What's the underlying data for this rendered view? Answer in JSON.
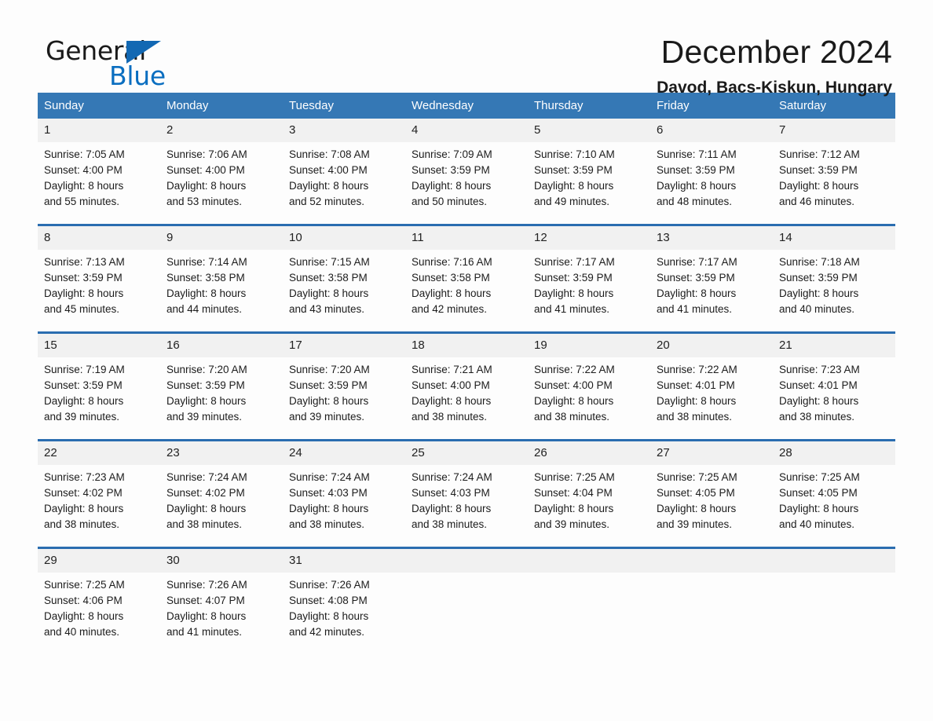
{
  "brand": {
    "name_part1": "General",
    "name_part2": "Blue",
    "triangle_color": "#1268b3",
    "blue_color": "#0a6ec0"
  },
  "header": {
    "month_title": "December 2024",
    "location": "Davod, Bacs-Kiskun, Hungary"
  },
  "theme": {
    "header_blue": "#3578b5",
    "row_divider_blue": "#2a6db0",
    "daynum_band": "#f1f1f1",
    "page_background": "#fdfdfd"
  },
  "calendar": {
    "weekday_headers": [
      "Sunday",
      "Monday",
      "Tuesday",
      "Wednesday",
      "Thursday",
      "Friday",
      "Saturday"
    ],
    "weeks": [
      [
        {
          "day": "1",
          "sunrise": "Sunrise: 7:05 AM",
          "sunset": "Sunset: 4:00 PM",
          "daylight_line1": "Daylight: 8 hours",
          "daylight_line2": "and 55 minutes."
        },
        {
          "day": "2",
          "sunrise": "Sunrise: 7:06 AM",
          "sunset": "Sunset: 4:00 PM",
          "daylight_line1": "Daylight: 8 hours",
          "daylight_line2": "and 53 minutes."
        },
        {
          "day": "3",
          "sunrise": "Sunrise: 7:08 AM",
          "sunset": "Sunset: 4:00 PM",
          "daylight_line1": "Daylight: 8 hours",
          "daylight_line2": "and 52 minutes."
        },
        {
          "day": "4",
          "sunrise": "Sunrise: 7:09 AM",
          "sunset": "Sunset: 3:59 PM",
          "daylight_line1": "Daylight: 8 hours",
          "daylight_line2": "and 50 minutes."
        },
        {
          "day": "5",
          "sunrise": "Sunrise: 7:10 AM",
          "sunset": "Sunset: 3:59 PM",
          "daylight_line1": "Daylight: 8 hours",
          "daylight_line2": "and 49 minutes."
        },
        {
          "day": "6",
          "sunrise": "Sunrise: 7:11 AM",
          "sunset": "Sunset: 3:59 PM",
          "daylight_line1": "Daylight: 8 hours",
          "daylight_line2": "and 48 minutes."
        },
        {
          "day": "7",
          "sunrise": "Sunrise: 7:12 AM",
          "sunset": "Sunset: 3:59 PM",
          "daylight_line1": "Daylight: 8 hours",
          "daylight_line2": "and 46 minutes."
        }
      ],
      [
        {
          "day": "8",
          "sunrise": "Sunrise: 7:13 AM",
          "sunset": "Sunset: 3:59 PM",
          "daylight_line1": "Daylight: 8 hours",
          "daylight_line2": "and 45 minutes."
        },
        {
          "day": "9",
          "sunrise": "Sunrise: 7:14 AM",
          "sunset": "Sunset: 3:58 PM",
          "daylight_line1": "Daylight: 8 hours",
          "daylight_line2": "and 44 minutes."
        },
        {
          "day": "10",
          "sunrise": "Sunrise: 7:15 AM",
          "sunset": "Sunset: 3:58 PM",
          "daylight_line1": "Daylight: 8 hours",
          "daylight_line2": "and 43 minutes."
        },
        {
          "day": "11",
          "sunrise": "Sunrise: 7:16 AM",
          "sunset": "Sunset: 3:58 PM",
          "daylight_line1": "Daylight: 8 hours",
          "daylight_line2": "and 42 minutes."
        },
        {
          "day": "12",
          "sunrise": "Sunrise: 7:17 AM",
          "sunset": "Sunset: 3:59 PM",
          "daylight_line1": "Daylight: 8 hours",
          "daylight_line2": "and 41 minutes."
        },
        {
          "day": "13",
          "sunrise": "Sunrise: 7:17 AM",
          "sunset": "Sunset: 3:59 PM",
          "daylight_line1": "Daylight: 8 hours",
          "daylight_line2": "and 41 minutes."
        },
        {
          "day": "14",
          "sunrise": "Sunrise: 7:18 AM",
          "sunset": "Sunset: 3:59 PM",
          "daylight_line1": "Daylight: 8 hours",
          "daylight_line2": "and 40 minutes."
        }
      ],
      [
        {
          "day": "15",
          "sunrise": "Sunrise: 7:19 AM",
          "sunset": "Sunset: 3:59 PM",
          "daylight_line1": "Daylight: 8 hours",
          "daylight_line2": "and 39 minutes."
        },
        {
          "day": "16",
          "sunrise": "Sunrise: 7:20 AM",
          "sunset": "Sunset: 3:59 PM",
          "daylight_line1": "Daylight: 8 hours",
          "daylight_line2": "and 39 minutes."
        },
        {
          "day": "17",
          "sunrise": "Sunrise: 7:20 AM",
          "sunset": "Sunset: 3:59 PM",
          "daylight_line1": "Daylight: 8 hours",
          "daylight_line2": "and 39 minutes."
        },
        {
          "day": "18",
          "sunrise": "Sunrise: 7:21 AM",
          "sunset": "Sunset: 4:00 PM",
          "daylight_line1": "Daylight: 8 hours",
          "daylight_line2": "and 38 minutes."
        },
        {
          "day": "19",
          "sunrise": "Sunrise: 7:22 AM",
          "sunset": "Sunset: 4:00 PM",
          "daylight_line1": "Daylight: 8 hours",
          "daylight_line2": "and 38 minutes."
        },
        {
          "day": "20",
          "sunrise": "Sunrise: 7:22 AM",
          "sunset": "Sunset: 4:01 PM",
          "daylight_line1": "Daylight: 8 hours",
          "daylight_line2": "and 38 minutes."
        },
        {
          "day": "21",
          "sunrise": "Sunrise: 7:23 AM",
          "sunset": "Sunset: 4:01 PM",
          "daylight_line1": "Daylight: 8 hours",
          "daylight_line2": "and 38 minutes."
        }
      ],
      [
        {
          "day": "22",
          "sunrise": "Sunrise: 7:23 AM",
          "sunset": "Sunset: 4:02 PM",
          "daylight_line1": "Daylight: 8 hours",
          "daylight_line2": "and 38 minutes."
        },
        {
          "day": "23",
          "sunrise": "Sunrise: 7:24 AM",
          "sunset": "Sunset: 4:02 PM",
          "daylight_line1": "Daylight: 8 hours",
          "daylight_line2": "and 38 minutes."
        },
        {
          "day": "24",
          "sunrise": "Sunrise: 7:24 AM",
          "sunset": "Sunset: 4:03 PM",
          "daylight_line1": "Daylight: 8 hours",
          "daylight_line2": "and 38 minutes."
        },
        {
          "day": "25",
          "sunrise": "Sunrise: 7:24 AM",
          "sunset": "Sunset: 4:03 PM",
          "daylight_line1": "Daylight: 8 hours",
          "daylight_line2": "and 38 minutes."
        },
        {
          "day": "26",
          "sunrise": "Sunrise: 7:25 AM",
          "sunset": "Sunset: 4:04 PM",
          "daylight_line1": "Daylight: 8 hours",
          "daylight_line2": "and 39 minutes."
        },
        {
          "day": "27",
          "sunrise": "Sunrise: 7:25 AM",
          "sunset": "Sunset: 4:05 PM",
          "daylight_line1": "Daylight: 8 hours",
          "daylight_line2": "and 39 minutes."
        },
        {
          "day": "28",
          "sunrise": "Sunrise: 7:25 AM",
          "sunset": "Sunset: 4:05 PM",
          "daylight_line1": "Daylight: 8 hours",
          "daylight_line2": "and 40 minutes."
        }
      ],
      [
        {
          "day": "29",
          "sunrise": "Sunrise: 7:25 AM",
          "sunset": "Sunset: 4:06 PM",
          "daylight_line1": "Daylight: 8 hours",
          "daylight_line2": "and 40 minutes."
        },
        {
          "day": "30",
          "sunrise": "Sunrise: 7:26 AM",
          "sunset": "Sunset: 4:07 PM",
          "daylight_line1": "Daylight: 8 hours",
          "daylight_line2": "and 41 minutes."
        },
        {
          "day": "31",
          "sunrise": "Sunrise: 7:26 AM",
          "sunset": "Sunset: 4:08 PM",
          "daylight_line1": "Daylight: 8 hours",
          "daylight_line2": "and 42 minutes."
        },
        {
          "day": "",
          "sunrise": "",
          "sunset": "",
          "daylight_line1": "",
          "daylight_line2": ""
        },
        {
          "day": "",
          "sunrise": "",
          "sunset": "",
          "daylight_line1": "",
          "daylight_line2": ""
        },
        {
          "day": "",
          "sunrise": "",
          "sunset": "",
          "daylight_line1": "",
          "daylight_line2": ""
        },
        {
          "day": "",
          "sunrise": "",
          "sunset": "",
          "daylight_line1": "",
          "daylight_line2": ""
        }
      ]
    ]
  }
}
